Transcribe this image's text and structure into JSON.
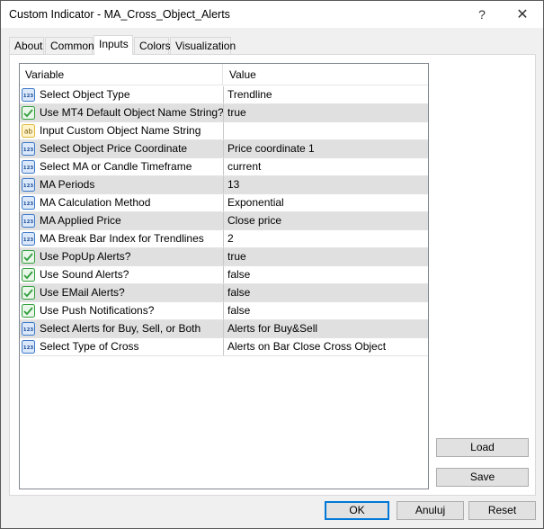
{
  "window": {
    "title": "Custom Indicator - MA_Cross_Object_Alerts",
    "help": "?",
    "close": "✕"
  },
  "tabs": [
    {
      "label": "About"
    },
    {
      "label": "Common"
    },
    {
      "label": "Inputs"
    },
    {
      "label": "Colors"
    },
    {
      "label": "Visualization"
    }
  ],
  "active_tab": "Inputs",
  "grid": {
    "headers": {
      "variable": "Variable",
      "value": "Value"
    },
    "rows": [
      {
        "icon": "number-icon",
        "name": "Select Object Type",
        "value": "Trendline"
      },
      {
        "icon": "bool-icon",
        "name": "Use MT4 Default Object Name String?",
        "value": "true"
      },
      {
        "icon": "string-icon",
        "name": "Input Custom Object Name String",
        "value": ""
      },
      {
        "icon": "number-icon",
        "name": "Select Object Price Coordinate",
        "value": "Price coordinate 1"
      },
      {
        "icon": "number-icon",
        "name": "Select MA or Candle Timeframe",
        "value": "current"
      },
      {
        "icon": "number-icon",
        "name": "MA Periods",
        "value": "13"
      },
      {
        "icon": "number-icon",
        "name": "MA Calculation Method",
        "value": "Exponential"
      },
      {
        "icon": "number-icon",
        "name": "MA Applied Price",
        "value": "Close price"
      },
      {
        "icon": "number-icon",
        "name": "MA Break Bar Index for Trendlines",
        "value": "2"
      },
      {
        "icon": "bool-icon",
        "name": "Use PopUp Alerts?",
        "value": "true"
      },
      {
        "icon": "bool-icon",
        "name": "Use Sound Alerts?",
        "value": "false"
      },
      {
        "icon": "bool-icon",
        "name": "Use EMail Alerts?",
        "value": "false"
      },
      {
        "icon": "bool-icon",
        "name": "Use Push Notifications?",
        "value": "false"
      },
      {
        "icon": "number-icon",
        "name": "Select Alerts for Buy, Sell, or Both",
        "value": "Alerts for Buy&Sell"
      },
      {
        "icon": "number-icon",
        "name": "Select Type of Cross",
        "value": "Alerts on Bar Close Cross Object"
      }
    ]
  },
  "side_buttons": {
    "load": "Load",
    "save": "Save"
  },
  "footer_buttons": {
    "ok": "OK",
    "cancel": "Anuluj",
    "reset": "Reset"
  },
  "icon_glyphs": {
    "number-icon": "123",
    "string-icon": "ab"
  },
  "colors": {
    "number_icon": "#3a78c8",
    "bool_icon": "#2e9e3a",
    "string_icon": "#e0b93a"
  }
}
